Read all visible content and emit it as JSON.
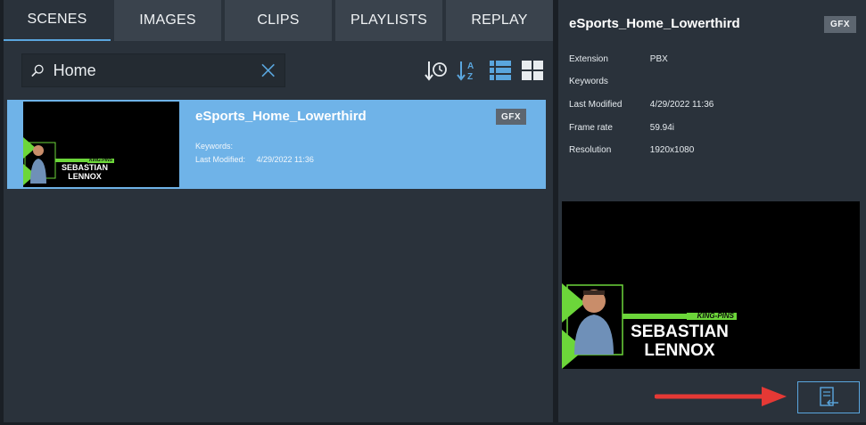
{
  "tabs": [
    "SCENES",
    "IMAGES",
    "CLIPS",
    "PLAYLISTS",
    "REPLAY"
  ],
  "active_tab": "SCENES",
  "search": {
    "value": "Home",
    "placeholder": ""
  },
  "scene": {
    "title": "eSports_Home_Lowerthird",
    "badge": "GFX",
    "keywords_label": "Keywords:",
    "keywords_value": "",
    "modified_label": "Last Modified:",
    "modified_value": "4/29/2022 11:36",
    "graphic": {
      "tag": "KING-PINS",
      "first": "SEBASTIAN",
      "last": "LENNOX"
    }
  },
  "details": {
    "title": "eSports_Home_Lowerthird",
    "badge": "GFX",
    "rows": [
      {
        "label": "Extension",
        "value": "PBX"
      },
      {
        "label": "Keywords",
        "value": ""
      },
      {
        "label": "Last Modified",
        "value": "4/29/2022 11:36"
      },
      {
        "label": "Frame rate",
        "value": "59.94i"
      },
      {
        "label": "Resolution",
        "value": "1920x1080"
      }
    ]
  },
  "colors": {
    "accent": "#5aa6de",
    "selected_row": "#6fb3e8",
    "annotation_arrow": "#e53935",
    "graphic_green": "#6cd63a"
  },
  "icons": [
    "search-icon",
    "clear-icon",
    "sort-by-time-icon",
    "sort-alphabetical-icon",
    "list-view-icon",
    "grid-view-icon",
    "apply-scene-icon"
  ]
}
